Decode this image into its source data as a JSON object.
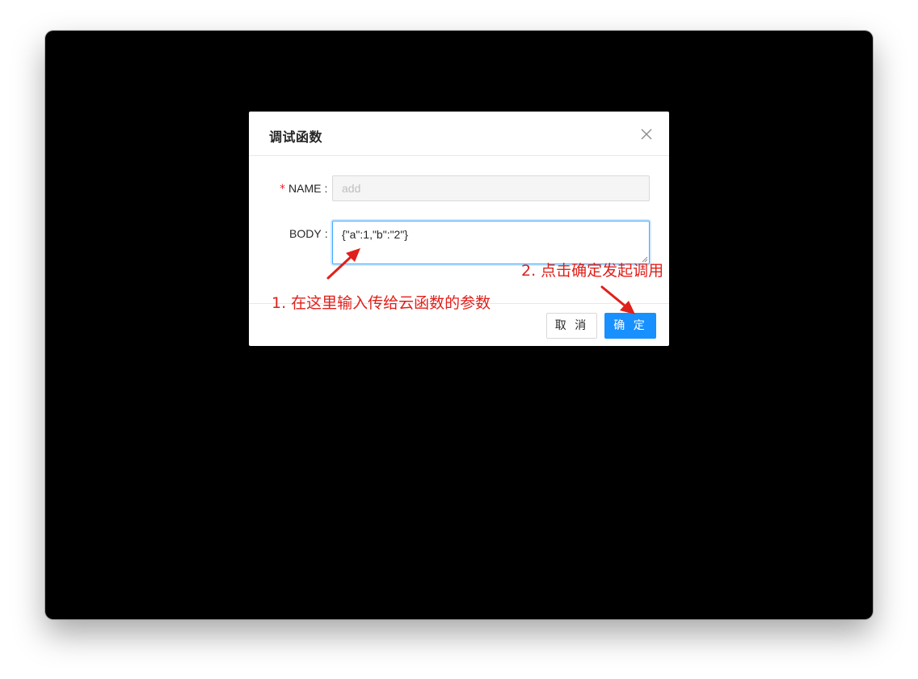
{
  "modal": {
    "title": "调试函数",
    "close_icon": "close-icon",
    "fields": {
      "name": {
        "label": "NAME",
        "required_mark": "*",
        "colon": ":",
        "value": "add",
        "disabled": true
      },
      "body": {
        "label": "BODY",
        "colon": ":",
        "value": "{\"a\":1,\"b\":\"2\"}"
      }
    },
    "footer": {
      "cancel_label": "取 消",
      "ok_label": "确 定"
    }
  },
  "annotations": {
    "step1": "1. 在这里输入传给云函数的参数",
    "step2": "2. 点击确定发起调用",
    "color": "#e0201b"
  },
  "colors": {
    "backdrop": "#000000",
    "primary": "#1890ff",
    "required": "#f5222d"
  }
}
